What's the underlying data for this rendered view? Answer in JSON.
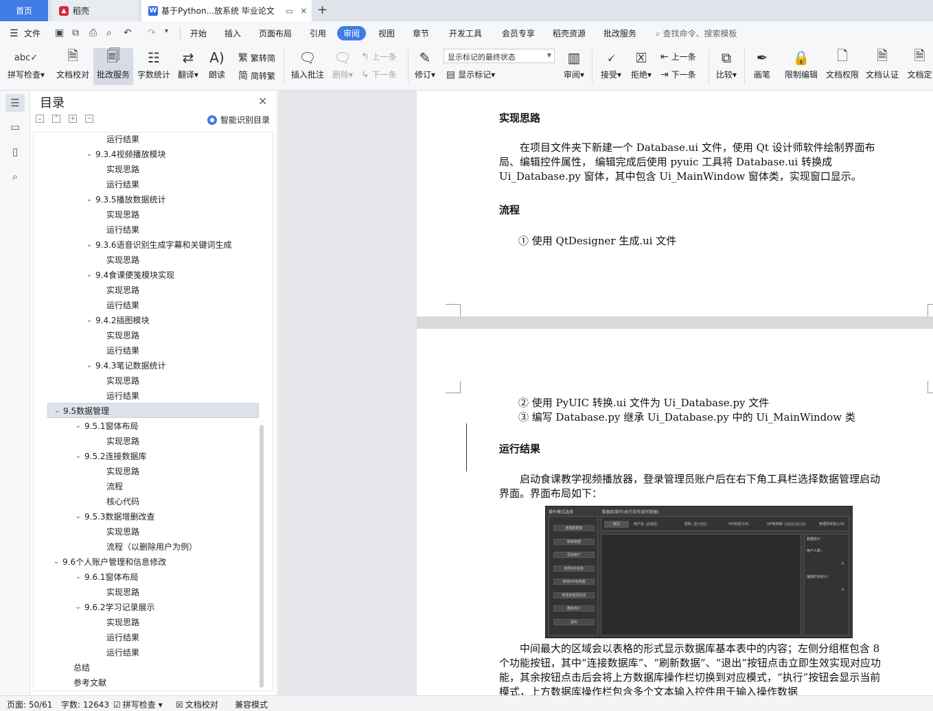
{
  "tabs": {
    "home": "首页",
    "daoke": "稻壳",
    "doc": "基于Python...放系统 毕业论文"
  },
  "menu": {
    "file": "文件",
    "items": [
      "开始",
      "插入",
      "页面布局",
      "引用",
      "审阅",
      "视图",
      "章节",
      "开发工具",
      "会员专享",
      "稻壳资源",
      "批改服务"
    ],
    "active": "审阅",
    "search": "查找命令、搜索模板"
  },
  "ribbon": {
    "spell": "拼写检查",
    "proof": "文档校对",
    "correct": "批改服务",
    "wordcount": "字数统计",
    "translate": "翻译",
    "read": "朗读",
    "trad": "繁转简",
    "simp": "简转繁",
    "insert_comment": "插入批注",
    "delete": "删除",
    "prev": "上一条",
    "next": "下一条",
    "revise": "修订",
    "markup_state": "显示标记的最终状态",
    "show_markup": "显示标记",
    "review": "审阅",
    "accept": "接受",
    "reject": "拒绝",
    "prev2": "上一条",
    "next2": "下一条",
    "compare": "比较",
    "pen": "画笔",
    "restrict": "限制编辑",
    "permission": "文档权限",
    "certify": "文档认证",
    "finalize": "文档定"
  },
  "toc": {
    "title": "目录",
    "ai_label": "智能识别目录",
    "rows": [
      {
        "text": "运行结果",
        "level": 4,
        "caret": ""
      },
      {
        "text": "9.3.4视频播放模块",
        "level": 3,
        "caret": "v"
      },
      {
        "text": "实现思路",
        "level": 4,
        "caret": ""
      },
      {
        "text": "运行结果",
        "level": 4,
        "caret": ""
      },
      {
        "text": "9.3.5播放数据统计",
        "level": 3,
        "caret": "v"
      },
      {
        "text": "实现思路",
        "level": 4,
        "caret": ""
      },
      {
        "text": "运行结果",
        "level": 4,
        "caret": ""
      },
      {
        "text": "9.3.6语音识别生成字幕和关键词生成",
        "level": 3,
        "caret": "v"
      },
      {
        "text": "实现思路",
        "level": 4,
        "caret": ""
      },
      {
        "text": "9.4食课便笺模块实现",
        "level": 3,
        "caret": "v"
      },
      {
        "text": "实现思路",
        "level": 4,
        "caret": ""
      },
      {
        "text": "运行结果",
        "level": 4,
        "caret": ""
      },
      {
        "text": "9.4.2插图模块",
        "level": 3,
        "caret": "v"
      },
      {
        "text": "实现思路",
        "level": 4,
        "caret": ""
      },
      {
        "text": "运行结果",
        "level": 4,
        "caret": ""
      },
      {
        "text": "9.4.3笔记数据统计",
        "level": 3,
        "caret": "v"
      },
      {
        "text": "实现思路",
        "level": 4,
        "caret": ""
      },
      {
        "text": "运行结果",
        "level": 4,
        "caret": ""
      },
      {
        "text": "9.5数据管理",
        "level": 1,
        "caret": "v",
        "selected": true
      },
      {
        "text": "9.5.1窗体布局",
        "level": 2,
        "caret": "v"
      },
      {
        "text": "实现思路",
        "level": 4,
        "caret": ""
      },
      {
        "text": "9.5.2连接数据库",
        "level": 2,
        "caret": "v"
      },
      {
        "text": "实现思路",
        "level": 4,
        "caret": ""
      },
      {
        "text": "流程",
        "level": 4,
        "caret": ""
      },
      {
        "text": "核心代码",
        "level": 4,
        "caret": ""
      },
      {
        "text": "9.5.3数据增删改查",
        "level": 2,
        "caret": "v"
      },
      {
        "text": "实现思路",
        "level": 4,
        "caret": ""
      },
      {
        "text": "流程（以删除用户为例）",
        "level": 4,
        "caret": ""
      },
      {
        "text": "9.6个人账户管理和信息修改",
        "level": 1,
        "caret": "v"
      },
      {
        "text": "9.6.1窗体布局",
        "level": 2,
        "caret": "v"
      },
      {
        "text": "实现思路",
        "level": 4,
        "caret": ""
      },
      {
        "text": "9.6.2学习记录展示",
        "level": 2,
        "caret": "v"
      },
      {
        "text": "实现思路",
        "level": 4,
        "caret": ""
      },
      {
        "text": "运行结果",
        "level": 4,
        "caret": ""
      },
      {
        "text": "运行结果",
        "level": 4,
        "caret": ""
      },
      {
        "text": "总结",
        "level": 0,
        "caret": ""
      },
      {
        "text": "参考文献",
        "level": 0,
        "caret": ""
      }
    ]
  },
  "doc": {
    "p1_h1": "实现思路",
    "p1_para": "在项目文件夹下新建一个 Database.ui 文件，使用 Qt 设计师软件绘制界面布局、编辑控件属性， 编辑完成后使用 pyuic 工具将 Database.ui 转换成 Ui_Database.py 窗体，其中包含 Ui_MainWindow 窗体类，实现窗口显示。",
    "p1_h2": "流程",
    "p1_li1": "①  使用 QtDesigner 生成.ui 文件",
    "p2_li2": "②  使用 PyUIC 转换.ui 文件为 Ui_Database.py 文件",
    "p2_li3": "③  编写 Database.py 继承 Ui_Database.py 中的 Ui_MainWindow 类",
    "p2_h": "运行结果",
    "p2_para1": "启动食课教学视频播放器，登录管理员账户后在右下角工具栏选择数据管理启动界面。界面布局如下：",
    "p2_para2": "中间最大的区域会以表格的形式显示数据库基本表中的内容；左侧分组框包含 8 个功能按钮，其中“连接数据库”、“刷新数据”、“退出”按钮点击立即生效实现对应功能，其余按钮点击后会将上方数据库操作栏切换到对应模式，“执行”按钮会显示当前模式，上方数据库操作栏包含多个文本输入控件用于输入操作数据"
  },
  "shot": {
    "hdr_left": "操作模式选择",
    "hdr_right": "数据库操作(执行前先填写数据)",
    "buttons": [
      "连接数据库",
      "刷新数据",
      "添加用户",
      "修改VIP状态",
      "修改VIP有效期",
      "修改管理员状态",
      "删除用户",
      "退出"
    ],
    "exec": "执行",
    "f_user": "用户名",
    "f_user_ph": "必填项",
    "f_pwd": "密码",
    "f_pwd_ph": "至少8位",
    "f_vip": "VIP状态(1/0)",
    "f_vip_date": "VIP有效期",
    "f_vip_date_val": "2021-01-30",
    "f_admin": "管理员状态(1/0)",
    "stat_title": "数据统计",
    "stat_users": "用户人数：",
    "stat_users_val": "0",
    "stat_time": "播放时长统计：",
    "stat_time_val": "0"
  },
  "status": {
    "page": "页面: 50/61",
    "words": "字数: 12643",
    "spell": "拼写检查",
    "proof": "文档校对",
    "compat": "兼容模式"
  }
}
